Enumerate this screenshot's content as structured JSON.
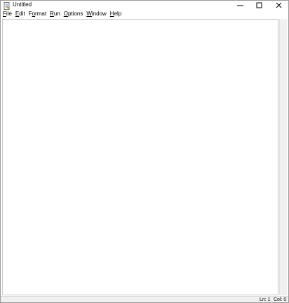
{
  "window": {
    "title": "Untitled",
    "app_icon": "python-idle-icon"
  },
  "menubar": {
    "items": [
      {
        "label": "File",
        "mnemonic": "F",
        "rest": "ile"
      },
      {
        "label": "Edit",
        "mnemonic": "E",
        "rest": "dit"
      },
      {
        "label": "Format",
        "mnemonic": "",
        "rest": "Format",
        "pre": "F",
        "ul": "o",
        "post": "rmat"
      },
      {
        "label": "Run",
        "mnemonic": "R",
        "rest": "un"
      },
      {
        "label": "Options",
        "mnemonic": "O",
        "rest": "ptions"
      },
      {
        "label": "Window",
        "mnemonic": "W",
        "rest": "indow"
      },
      {
        "label": "Help",
        "mnemonic": "H",
        "rest": "elp"
      }
    ]
  },
  "editor": {
    "content": ""
  },
  "statusbar": {
    "line": "Ln: 1",
    "column": "Col: 0"
  },
  "colors": {
    "window_border": "#9a9a9a",
    "background": "#ffffff",
    "statusbar": "#f0f0f0"
  }
}
